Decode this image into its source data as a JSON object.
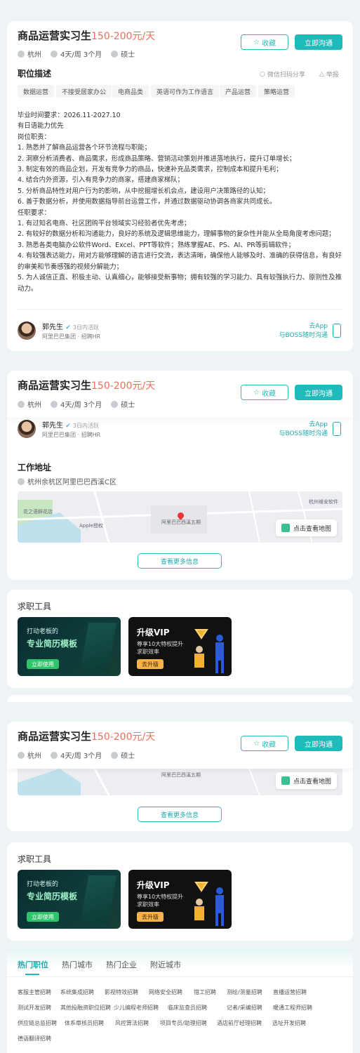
{
  "job": {
    "title": "商品运营实习生",
    "salary": "150-200元/天",
    "city": "杭州",
    "schedule": "4天/周 3个月",
    "degree": "硕士",
    "fav_label": "收藏",
    "chat_label": "立即沟通"
  },
  "description": {
    "heading": "职位描述",
    "share_label": "微信扫码分享",
    "report_label": "举报",
    "tags": [
      "数据运营",
      "不接受居家办公",
      "电商品类",
      "英语可作为工作语言",
      "产品运营",
      "策略运营"
    ],
    "lines": [
      "毕业时间要求：2026.11-2027.10",
      "有日语能力优先",
      "岗位职责：",
      "1. 熟悉并了解商品运营各个环节流程与职能；",
      "2. 洞察分析消费者、商品需求，形成商品策略、营销活动策划并推进落地执行，提升订单增长；",
      "3. 制定有效的商品企划，开发有竞争力的商品，快速补充品类需求，控制成本和提升毛利；",
      "4. 结合内外资源，引入有竞争力的商家，搭建商家梯队；",
      "5. 分析商品特性对用户行为的影响，从中挖掘增长机会点，建设用户决策路径的认知；",
      "6. 善于数据分析，并使用数据指导前台运营工作，并通过数据驱动协调各商家共同成长。",
      "任职要求：",
      "1. 有过知名电商、社区团购平台领域实习经验者优先考虑；",
      "2. 有较好的数据分析和沟通能力，良好的系统及逻辑思维能力，理解事物的复杂性并能从全局角度考虑问题；",
      "3. 熟悉各类电脑办公软件Word、Excel、PPT等软件；熟练掌握AE、PS、AI、PR等剪辑软件；",
      "4. 有较强表达能力，用对方能够理解的语言进行交流，表达清晰，确保他人能够及时、准确的获得信息，有良好的审美和节奏感强的视频分解能力；",
      "5. 为人诚信正直、积极主动、认真细心，能够接受新事物；拥有较强的学习能力、具有较强执行力、原则性及推动力。"
    ]
  },
  "recruiter": {
    "name": "郭先生",
    "active": "3日内活跃",
    "company_role": "阿里巴巴集团 · 招聘HR",
    "app_line1": "去App",
    "app_line2": "与BOSS随时沟通"
  },
  "location": {
    "heading": "工作地址",
    "address": "杭州余杭区阿里巴巴西溪C区",
    "view_map_label": "点击查看地图",
    "map_labels": [
      "花之语鲜花店",
      "Apple授权",
      "阿里巴巴西溪五期",
      "杭州维安软件"
    ],
    "more_label": "查看更多信息"
  },
  "tools": {
    "heading": "求职工具",
    "resume": {
      "line1": "打动老板的",
      "line2": "专业简历模板",
      "button": "立即使用"
    },
    "vip": {
      "title": "升级VIP",
      "line1": "尊享10大特权提升",
      "line2": "求职效率",
      "button": "去升级"
    }
  },
  "hot": {
    "tabs": [
      "热门职位",
      "热门城市",
      "热门企业",
      "附近城市"
    ],
    "links": [
      [
        "客服主管招聘",
        "系统集成招聘",
        "影视特效招聘",
        "网络安全招聘",
        "钳工招聘",
        "测绘/测量招聘",
        "直播运营招聘"
      ],
      [
        "测试开发招聘",
        "其他投融资职位招聘",
        "少儿编程老师招聘",
        "临床监查员招聘",
        "记者/采编招聘",
        "暖通工程师招聘"
      ],
      [
        "供应链总监招聘",
        "体系审核员招聘",
        "风控算法招聘",
        "项目专员/助理招聘",
        "酒店前厅经理招聘",
        "选址开发招聘"
      ],
      [
        "德语翻译招聘"
      ]
    ]
  },
  "colors": {
    "accent": "#1fbbbb",
    "salary": "#f26d5b"
  }
}
